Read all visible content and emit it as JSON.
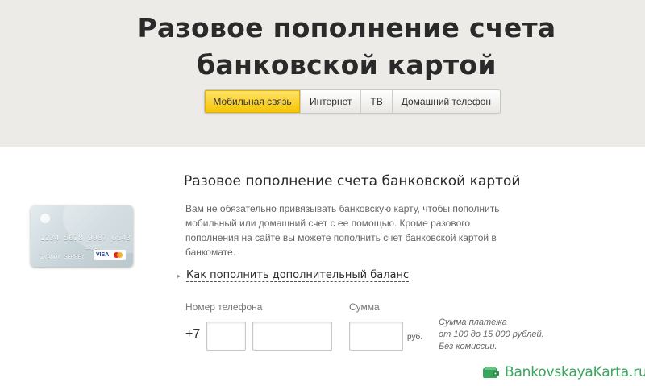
{
  "header": {
    "title_line1": "Разовое пополнение счета",
    "title_line2": "банковской картой",
    "tabs": [
      {
        "label": "Мобильная связь",
        "active": true
      },
      {
        "label": "Интернет",
        "active": false
      },
      {
        "label": "ТВ",
        "active": false
      },
      {
        "label": "Домашний телефон",
        "active": false
      }
    ]
  },
  "main": {
    "section_title": "Разовое пополнение счета банковской картой",
    "description": "Вам не обязательно привязывать банковскую карту, чтобы пополнить мобильный или домашний счет с ее помощью. Кроме разового пополнения на сайте вы можете пополнить счет банковской картой в банкомате.",
    "balance_link": "Как пополнить дополнительный баланс",
    "card": {
      "number": "1234 5678 9087 6543",
      "expiry": "12/10",
      "holder": "IVANOV SERGEY",
      "logo": "VISA"
    },
    "form": {
      "phone_label": "Номер телефона",
      "phone_prefix": "+7",
      "phone_code_value": "",
      "phone_number_value": "",
      "amount_label": "Сумма",
      "amount_value": "",
      "currency": "руб.",
      "hint_lines": [
        "Сумма платежа",
        "от 100 до 15 000 рублей.",
        "Без комиссии."
      ]
    }
  },
  "watermark": {
    "text": "BankovskayaKarta.ru",
    "icon": "wallet-icon"
  },
  "colors": {
    "header_bg": "#ecebe7",
    "active_tab": "#f5c400",
    "watermark": "#3aa55c"
  }
}
